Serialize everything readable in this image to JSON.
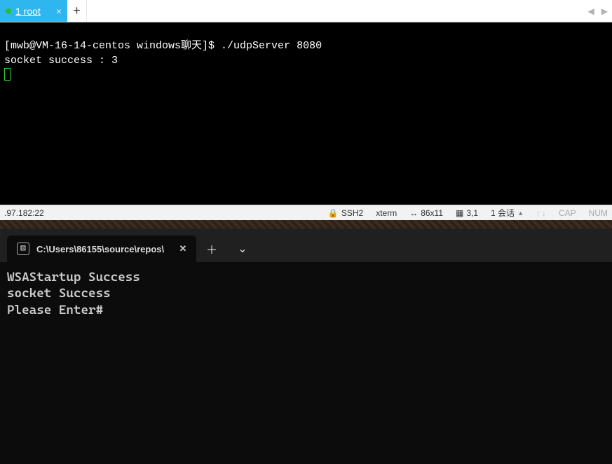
{
  "ssh": {
    "tab": {
      "label": "1 root",
      "dot_color": "#21c131",
      "close_glyph": "×"
    },
    "new_tab_glyph": "+",
    "nav_left_glyph": "◀",
    "nav_right_glyph": "▶",
    "prompt": "[mwb@VM-16-14-centos windows聊天]$ ",
    "command": "./udpServer 8080",
    "output_line1": "socket success : 3"
  },
  "statusbar": {
    "host": ".97.182:22",
    "lock_glyph": "🔒",
    "protocol": "SSH2",
    "term": "xterm",
    "size_glyph": "↔",
    "size": "86x11",
    "pos_glyph": "▦",
    "pos": "3,1",
    "sessions": "1 会话",
    "sessions_arrow": "▲",
    "up_glyph": "↑",
    "down_glyph": "↓",
    "cap": "CAP",
    "num": "NUM"
  },
  "winterm": {
    "tab": {
      "icon_glyph": "⊡",
      "title": "C:\\Users\\86155\\source\\repos\\",
      "close_glyph": "✕"
    },
    "new_tab_glyph": "＋",
    "chevron_glyph": "⌄",
    "line1": "WSAStartup Success",
    "line2": "socket Success",
    "line3": "Please Enter#"
  }
}
